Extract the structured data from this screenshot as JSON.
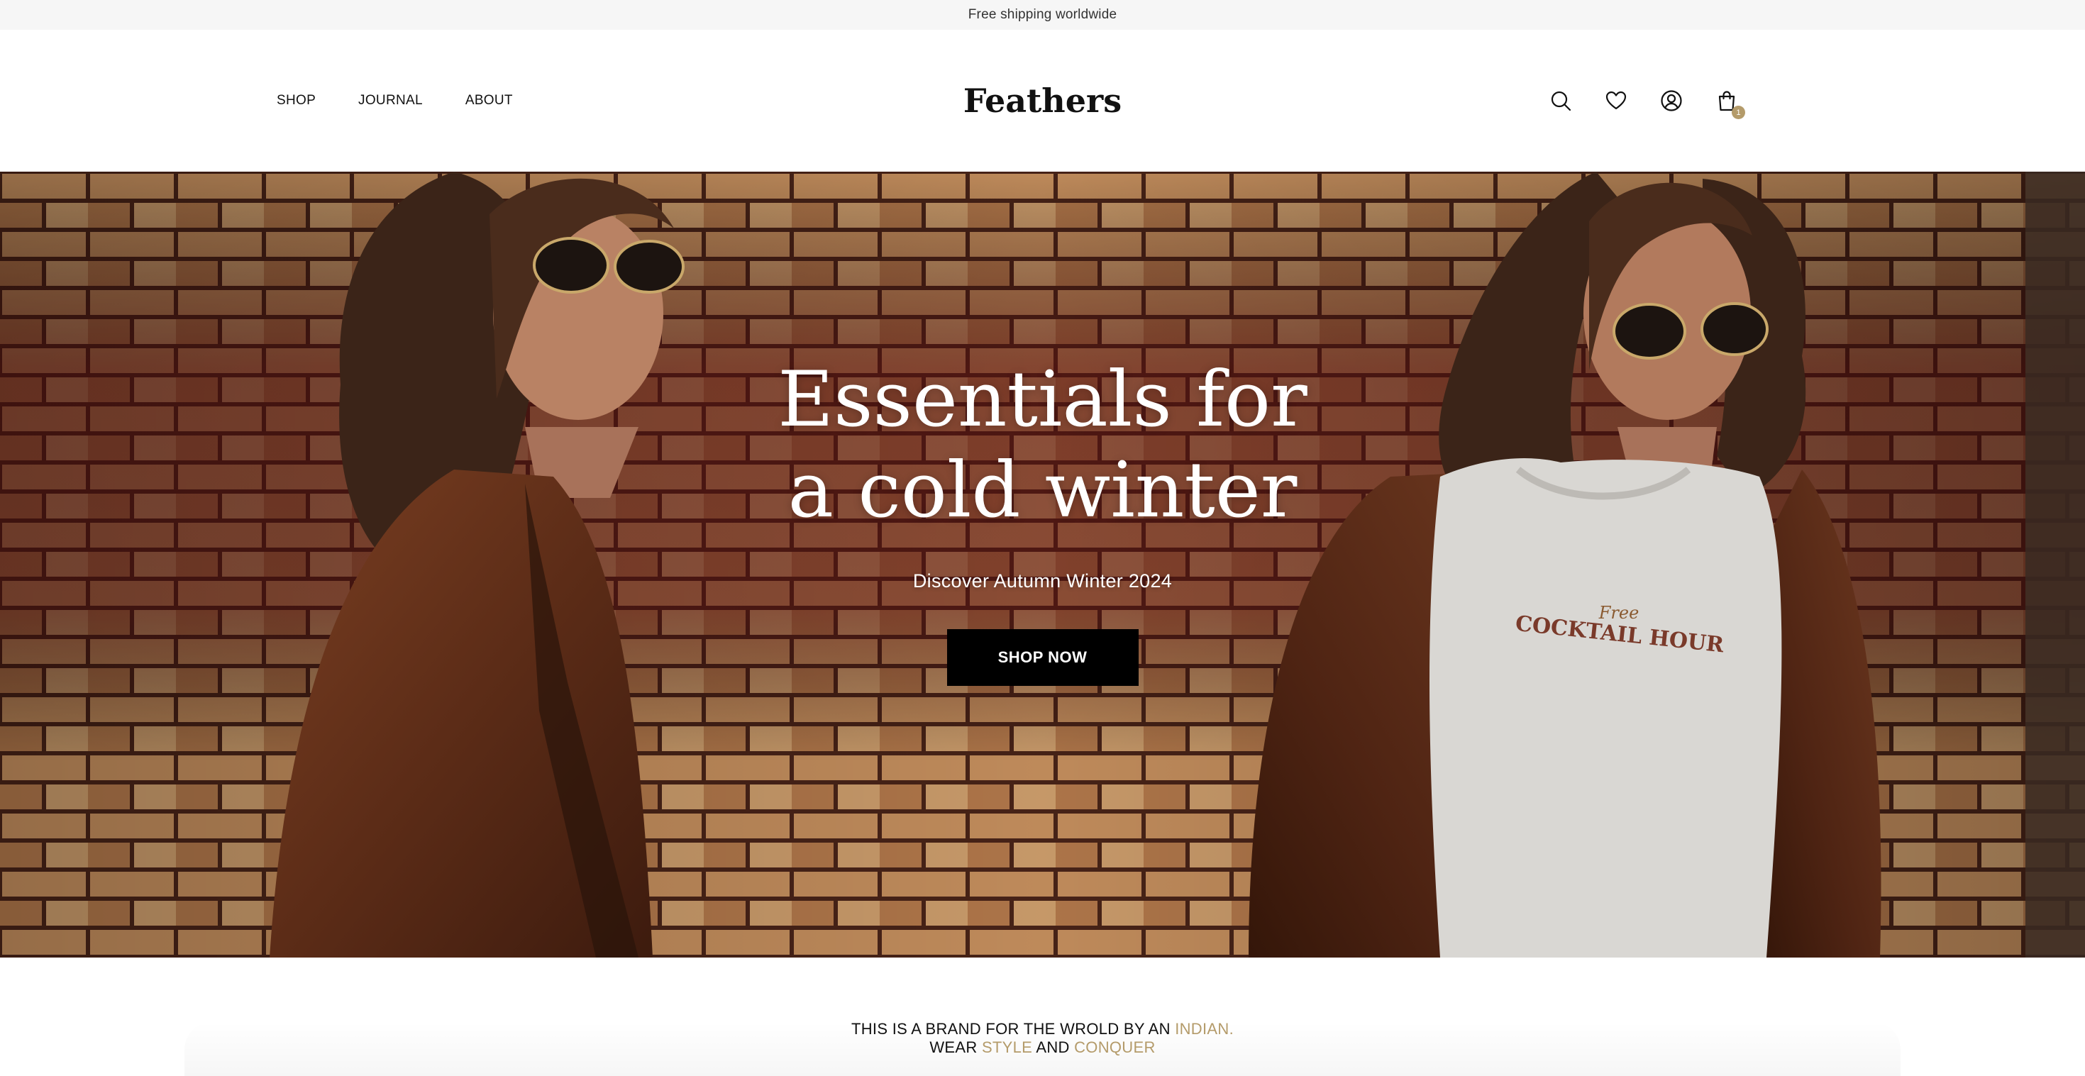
{
  "announcement": {
    "text": "Free shipping worldwide"
  },
  "header": {
    "nav": [
      {
        "label": "SHOP"
      },
      {
        "label": "JOURNAL"
      },
      {
        "label": "ABOUT"
      }
    ],
    "logo": "Feathers",
    "icons": [
      "search-icon",
      "heart-icon",
      "account-icon",
      "bag-icon"
    ],
    "cart_count": "1"
  },
  "hero": {
    "title_line1": "Essentials for",
    "title_line2": "a cold winter",
    "subtitle": "Discover Autumn Winter 2024",
    "cta_label": "SHOP NOW",
    "sweatshirt_print_top": "Free",
    "sweatshirt_print_main": "COCKTAIL HOUR"
  },
  "brand": {
    "line1_a": "THIS IS A BRAND FOR THE WROLD BY AN ",
    "line1_accent": "INDIAN.",
    "line2_a": "WEAR ",
    "line2_accent1": "STYLE",
    "line2_b": " AND ",
    "line2_accent2": "CONQUER"
  },
  "colors": {
    "accent": "#b49b6a",
    "announcement_bg": "#f6f6f6",
    "button_bg": "#000000"
  }
}
